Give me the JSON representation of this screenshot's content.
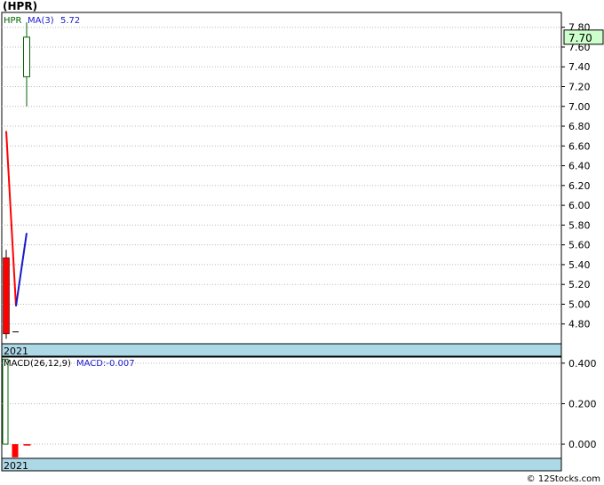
{
  "page_title": "(HPR)",
  "footer": "© 12Stocks.com",
  "colors": {
    "up": "#006400",
    "down": "#ff0000",
    "ma": "#1a1acc",
    "macd_label": "#1a1acc",
    "band": "#add8e6"
  },
  "chart_data": [
    {
      "type": "candlestick",
      "title": "(HPR)",
      "legend": {
        "ticker": "HPR",
        "ma_label": "MA(3)",
        "ma_value": "5.72"
      },
      "last_price_label": "7.70",
      "ylim": [
        4.6,
        7.95
      ],
      "yticks": [
        {
          "value": 7.8,
          "label": "7.80"
        },
        {
          "value": 7.6,
          "label": "7.60"
        },
        {
          "value": 7.4,
          "label": "7.40"
        },
        {
          "value": 7.2,
          "label": "7.20"
        },
        {
          "value": 7.0,
          "label": "7.00"
        },
        {
          "value": 6.8,
          "label": "6.80"
        },
        {
          "value": 6.6,
          "label": "6.60"
        },
        {
          "value": 6.4,
          "label": "6.40"
        },
        {
          "value": 6.2,
          "label": "6.20"
        },
        {
          "value": 6.0,
          "label": "6.00"
        },
        {
          "value": 5.8,
          "label": "5.80"
        },
        {
          "value": 5.6,
          "label": "5.60"
        },
        {
          "value": 5.4,
          "label": "5.40"
        },
        {
          "value": 5.2,
          "label": "5.20"
        },
        {
          "value": 5.0,
          "label": "5.00"
        },
        {
          "value": 4.8,
          "label": "4.80"
        }
      ],
      "x_label": "2021",
      "candles": [
        {
          "open": 5.47,
          "high": 5.55,
          "low": 4.65,
          "close": 4.7,
          "direction": "down"
        },
        {
          "open": 4.72,
          "high": 4.72,
          "low": 4.72,
          "close": 4.72,
          "direction": "flat"
        },
        {
          "open": 7.3,
          "high": 7.85,
          "low": 7.0,
          "close": 7.7,
          "direction": "up"
        }
      ],
      "red_line": [
        6.75,
        4.98
      ],
      "ma_series": [
        4.98,
        5.72
      ]
    },
    {
      "type": "bar",
      "title": "MACD(26,12,9)",
      "legend": {
        "name": "MACD(26,12,9)",
        "value_label": "MACD:-0.007"
      },
      "x_label": "2021",
      "ylim": [
        -0.07,
        0.43
      ],
      "yticks": [
        {
          "value": 0.4,
          "label": "0.400"
        },
        {
          "value": 0.2,
          "label": "0.200"
        },
        {
          "value": 0.0,
          "label": "0.000"
        }
      ],
      "bars": [
        {
          "value": 0.42,
          "direction": "up"
        },
        {
          "value": -0.065,
          "direction": "down"
        },
        {
          "value": -0.007,
          "direction": "down"
        }
      ]
    }
  ]
}
